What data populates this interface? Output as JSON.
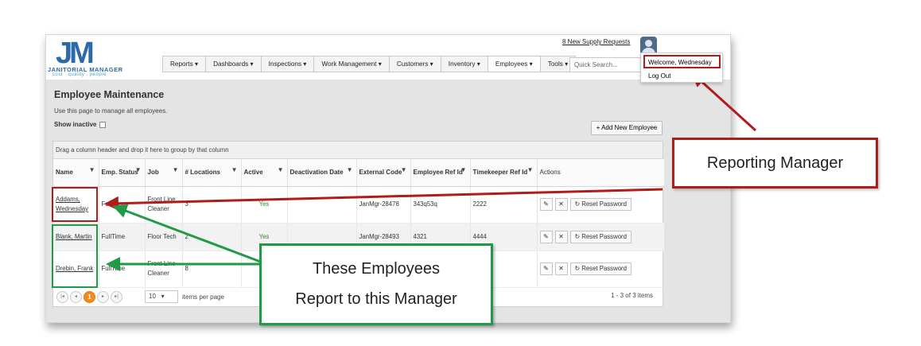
{
  "app": {
    "logo_mark": "JM",
    "logo_name": "JANITORIAL MANAGER",
    "logo_tagline": "cost . quality . people",
    "supply_link": "8 New Supply Requests"
  },
  "nav": {
    "items": [
      "Reports ▾",
      "Dashboards ▾",
      "Inspections ▾",
      "Work Management ▾",
      "Customers ▾",
      "Inventory ▾",
      "Employees ▾",
      "Tools ▾"
    ],
    "active_index": 6,
    "search_placeholder": "Quick Search..."
  },
  "user_menu": {
    "welcome": "Welcome, Wednesday",
    "logout": "Log Out"
  },
  "page": {
    "title": "Employee Maintenance",
    "description": "Use this page to manage all employees.",
    "show_inactive_label": "Show inactive",
    "show_inactive_checked": false,
    "add_button": "+ Add New Employee"
  },
  "grid": {
    "group_hint": "Drag a column header and drop it here to group by that column",
    "columns": [
      {
        "label": "Name"
      },
      {
        "label": "Emp. Status"
      },
      {
        "label": "Job"
      },
      {
        "label": "# Locations"
      },
      {
        "label": "Active"
      },
      {
        "label": "Deactivation Date"
      },
      {
        "label": "External Code"
      },
      {
        "label": "Employee Ref Id"
      },
      {
        "label": "Timekeeper Ref Id"
      },
      {
        "label": "Actions"
      }
    ],
    "rows": [
      {
        "name": "Addams, Wednesday",
        "status": "FullTime",
        "job": "Front Line Cleaner",
        "locations": "3",
        "active": "Yes",
        "deactivation": "",
        "external": "JanMgr-28478",
        "emp_ref": "343q53q",
        "timekeeper": "2222"
      },
      {
        "name": "Blank, Martin",
        "status": "FullTime",
        "job": "Floor Tech",
        "locations": "2",
        "active": "Yes",
        "deactivation": "",
        "external": "JanMgr-28493",
        "emp_ref": "4321",
        "timekeeper": "4444"
      },
      {
        "name": "Drebin, Frank",
        "status": "FullTime",
        "job": "Front Line Cleaner",
        "locations": "8",
        "active": "",
        "deactivation": "",
        "external": "",
        "emp_ref": "",
        "timekeeper": ""
      }
    ],
    "reset_label": "Reset Password",
    "edit_icon": "pencil-icon",
    "delete_icon": "close-icon"
  },
  "pager": {
    "first": "|◂",
    "prev": "◂",
    "current": "1",
    "next": "▸",
    "last": "▸|",
    "per_page": "10",
    "per_page_label": "items per page",
    "summary": "1 - 3 of 3 items"
  },
  "annotations": {
    "manager_callout": "Reporting Manager",
    "employees_callout_line1": "These Employees",
    "employees_callout_line2": "Report to this Manager",
    "manager_color": "#b01c1c",
    "employees_color": "#1f9a45"
  }
}
